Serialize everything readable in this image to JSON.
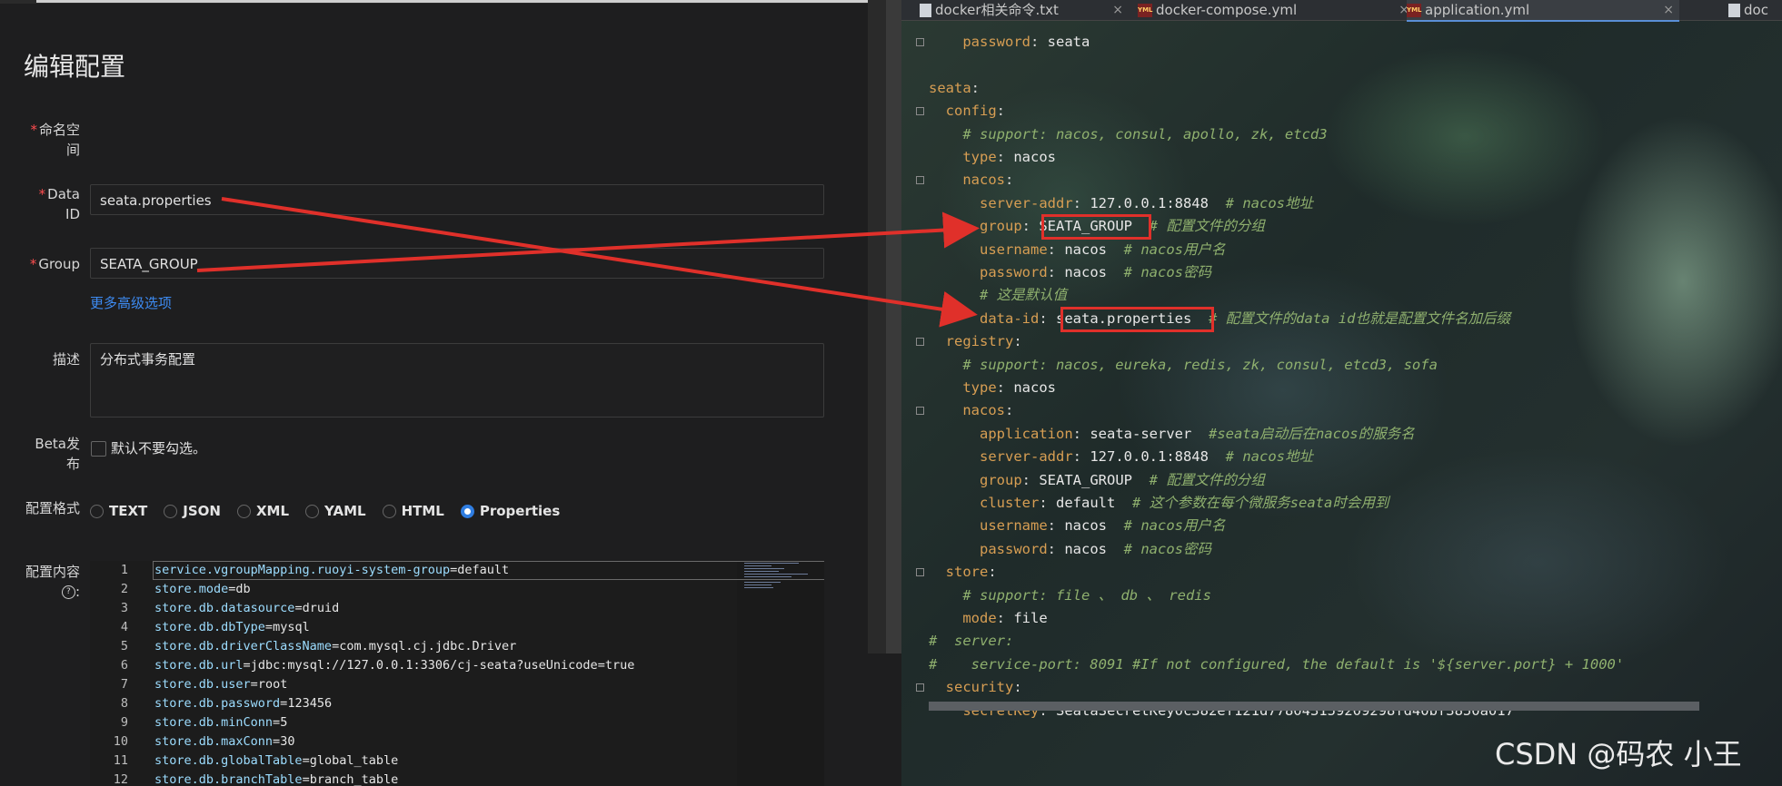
{
  "left": {
    "page_title": "编辑配置",
    "fields": {
      "namespace_label": "命名空间",
      "dataid_label": "Data ID",
      "dataid_value": "seata.properties",
      "group_label": "Group",
      "group_value": "SEATA_GROUP",
      "advanced_link": "更多高级选项",
      "desc_label": "描述",
      "desc_value": "分布式事务配置",
      "beta_label": "Beta发布",
      "beta_checkbox_text": "默认不要勾选。",
      "format_label": "配置格式",
      "content_label": "配置内容",
      "content_help_icon": "question-circle-icon"
    },
    "formats": [
      {
        "label": "TEXT",
        "selected": false
      },
      {
        "label": "JSON",
        "selected": false
      },
      {
        "label": "XML",
        "selected": false
      },
      {
        "label": "YAML",
        "selected": false
      },
      {
        "label": "HTML",
        "selected": false
      },
      {
        "label": "Properties",
        "selected": true
      }
    ],
    "code_lines": [
      {
        "n": "1",
        "key": "service.vgroupMapping.ruoyi-system-group",
        "val": "default"
      },
      {
        "n": "2",
        "key": "store.mode",
        "val": "db"
      },
      {
        "n": "3",
        "key": "store.db.datasource",
        "val": "druid"
      },
      {
        "n": "4",
        "key": "store.db.dbType",
        "val": "mysql"
      },
      {
        "n": "5",
        "key": "store.db.driverClassName",
        "val": "com.mysql.cj.jdbc.Driver"
      },
      {
        "n": "6",
        "key": "store.db.url",
        "val": "jdbc:mysql://127.0.0.1:3306/cj-seata?useUnicode=true"
      },
      {
        "n": "7",
        "key": "store.db.user",
        "val": "root"
      },
      {
        "n": "8",
        "key": "store.db.password",
        "val": "123456"
      },
      {
        "n": "9",
        "key": "store.db.minConn",
        "val": "5"
      },
      {
        "n": "10",
        "key": "store.db.maxConn",
        "val": "30"
      },
      {
        "n": "11",
        "key": "store.db.globalTable",
        "val": "global_table"
      },
      {
        "n": "12",
        "key": "store.db.branchTable",
        "val": "branch_table"
      }
    ]
  },
  "right": {
    "tabs": [
      {
        "label": "docker相关命令.txt",
        "icon": "txt-file-icon",
        "active": false
      },
      {
        "label": "docker-compose.yml",
        "icon": "yml-file-icon",
        "active": false
      },
      {
        "label": "application.yml",
        "icon": "yml-file-icon",
        "active": true
      },
      {
        "label": "doc",
        "icon": "txt-file-icon",
        "active": false
      }
    ],
    "yml_icon_text": "YML",
    "yaml_lines": [
      {
        "indent": "    ",
        "key": "password",
        "val": "seata",
        "comment": ""
      },
      {
        "indent": "",
        "key": "",
        "val": "",
        "comment": ""
      },
      {
        "indent": "",
        "key": "seata",
        "val": "",
        "comment": ""
      },
      {
        "indent": "  ",
        "key": "config",
        "val": "",
        "comment": ""
      },
      {
        "indent": "    ",
        "key": "",
        "val": "",
        "comment": "# support: nacos, consul, apollo, zk, etcd3"
      },
      {
        "indent": "    ",
        "key": "type",
        "val": "nacos",
        "comment": ""
      },
      {
        "indent": "    ",
        "key": "nacos",
        "val": "",
        "comment": ""
      },
      {
        "indent": "      ",
        "key": "server-addr",
        "val": "127.0.0.1:8848",
        "comment": "# nacos地址"
      },
      {
        "indent": "      ",
        "key": "group",
        "val": "SEATA_GROUP",
        "comment": "# 配置文件的分组"
      },
      {
        "indent": "      ",
        "key": "username",
        "val": "nacos",
        "comment": "# nacos用户名"
      },
      {
        "indent": "      ",
        "key": "password",
        "val": "nacos",
        "comment": "# nacos密码"
      },
      {
        "indent": "      ",
        "key": "",
        "val": "",
        "comment": "# 这是默认值"
      },
      {
        "indent": "      ",
        "key": "data-id",
        "val": "seata.properties",
        "comment": "# 配置文件的data id也就是配置文件名加后缀"
      },
      {
        "indent": "  ",
        "key": "registry",
        "val": "",
        "comment": ""
      },
      {
        "indent": "    ",
        "key": "",
        "val": "",
        "comment": "# support: nacos, eureka, redis, zk, consul, etcd3, sofa"
      },
      {
        "indent": "    ",
        "key": "type",
        "val": "nacos",
        "comment": ""
      },
      {
        "indent": "    ",
        "key": "nacos",
        "val": "",
        "comment": ""
      },
      {
        "indent": "      ",
        "key": "application",
        "val": "seata-server",
        "comment": "#seata启动后在nacos的服务名"
      },
      {
        "indent": "      ",
        "key": "server-addr",
        "val": "127.0.0.1:8848",
        "comment": "# nacos地址"
      },
      {
        "indent": "      ",
        "key": "group",
        "val": "SEATA_GROUP",
        "comment": "# 配置文件的分组"
      },
      {
        "indent": "      ",
        "key": "cluster",
        "val": "default",
        "comment": "# 这个参数在每个微服务seata时会用到"
      },
      {
        "indent": "      ",
        "key": "username",
        "val": "nacos",
        "comment": "# nacos用户名"
      },
      {
        "indent": "      ",
        "key": "password",
        "val": "nacos",
        "comment": "# nacos密码"
      },
      {
        "indent": "  ",
        "key": "store",
        "val": "",
        "comment": ""
      },
      {
        "indent": "    ",
        "key": "",
        "val": "",
        "comment": "# support: file 、 db 、 redis"
      },
      {
        "indent": "    ",
        "key": "mode",
        "val": "file",
        "comment": ""
      },
      {
        "indent": "",
        "key": "",
        "val": "",
        "comment": "#  server:"
      },
      {
        "indent": "",
        "key": "",
        "val": "",
        "comment": "#    service-port: 8091 #If not configured, the default is '${server.port} + 1000'"
      },
      {
        "indent": "  ",
        "key": "security",
        "val": "",
        "comment": ""
      },
      {
        "indent": "    ",
        "key": "secretKey",
        "val": "SeataSecretKey0c382ef121d778043159209298fd40bf3850a017",
        "comment": ""
      }
    ],
    "watermark": "CSDN @码农 小王",
    "highlight_color": "#e0302a"
  }
}
